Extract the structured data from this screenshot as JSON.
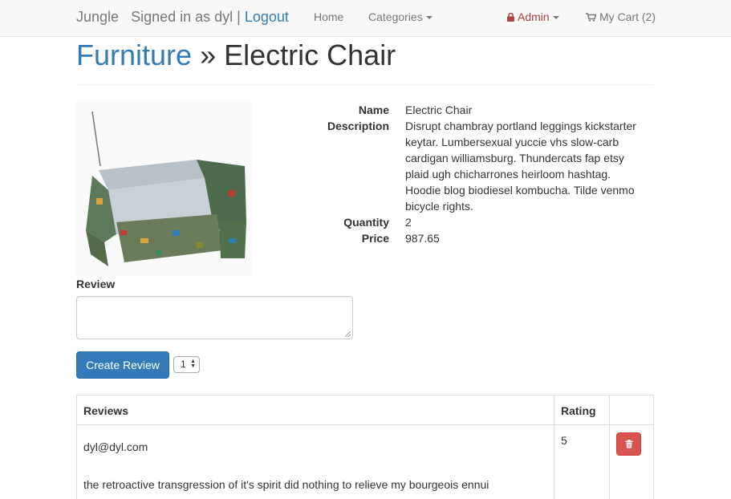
{
  "navbar": {
    "brand": "Jungle",
    "signed_in": "Signed in as dyl",
    "separator": "|",
    "logout": "Logout",
    "home": "Home",
    "categories": "Categories",
    "admin": "Admin",
    "cart": "My Cart (2)"
  },
  "page": {
    "category": "Furniture",
    "separator": "»",
    "title": "Electric Chair"
  },
  "product": {
    "name_label": "Name",
    "name": "Electric Chair",
    "description_label": "Description",
    "description": "Disrupt chambray portland leggings kickstarter keytar. Lumbersexual yuccie vhs slow-carb cardigan williamsburg. Thundercats fap etsy plaid ugh chicharrones heirloom hashtag. Hoodie blog biodiesel kombucha. Tilde venmo bicycle rights.",
    "quantity_label": "Quantity",
    "quantity": "2",
    "price_label": "Price",
    "price": "987.65"
  },
  "review_form": {
    "label": "Review",
    "textarea_value": "",
    "submit_label": "Create Review",
    "rating_selected": "1"
  },
  "reviews_table": {
    "headers": [
      "Reviews",
      "Rating",
      ""
    ],
    "rows": [
      {
        "author": "dyl@dyl.com",
        "text": "the retroactive transgression of it's spirit did nothing to relieve my bourgeois ennui",
        "rating": "5"
      }
    ]
  },
  "colors": {
    "link": "#337ab7",
    "admin": "#a94442",
    "primary_button": "#337ab7",
    "danger_button": "#d9534f"
  },
  "icons": [
    "lock-icon",
    "shopping-cart-icon",
    "caret-down-icon",
    "trash-icon",
    "chair-product-image"
  ]
}
